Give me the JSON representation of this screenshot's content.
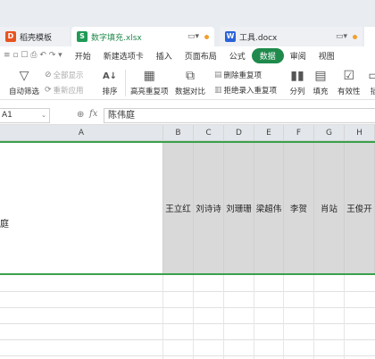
{
  "tabs": {
    "templates": {
      "label": "稻壳模板",
      "icon": "dk-icon"
    },
    "active": {
      "label": "数字填充.xlsx",
      "icon": "S"
    },
    "doc": {
      "label": "工具.docx",
      "icon": "W"
    }
  },
  "menu": [
    "开始",
    "新建选项卡",
    "插入",
    "页面布局",
    "公式",
    "数据",
    "审阅",
    "视图"
  ],
  "menu_prefix": "≡ ▫ ☐ ⎙ ↶ ↷ ▾",
  "menu_active_index": 5,
  "ribbon": {
    "autofilter": "自动筛选",
    "show_all": "全部显示",
    "reapply": "重新应用",
    "sort": "排序",
    "highlight_dup": "高亮重复项",
    "compare": "数据对比",
    "delete_dup": "删除重复项",
    "reject_dup": "拒绝录入重复项",
    "split": "分列",
    "fill": "填充",
    "validity": "有效性",
    "drop": "插"
  },
  "formula_bar": {
    "name_box": "A1",
    "fx": "fx",
    "content": "陈伟庭"
  },
  "columns": [
    "A",
    "B",
    "C",
    "D",
    "E",
    "F",
    "G",
    "H"
  ],
  "header_row": [
    "王立红",
    "刘诗诗",
    "刘珊珊",
    "梁超伟",
    "李贺",
    "肖站",
    "王俊开"
  ],
  "a1_fragment": "庭"
}
